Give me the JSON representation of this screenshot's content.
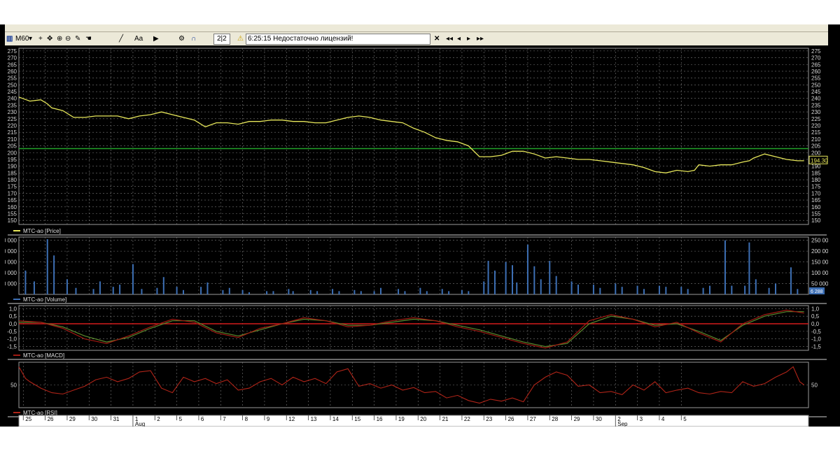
{
  "toolbar": {
    "timeframe": "M60",
    "font_button": "Aa",
    "counter": "2|2",
    "status": "6:25:15  Недостаточно лицензий!",
    "nav_buttons": [
      "◂◂",
      "◂",
      "▸",
      "▸▸"
    ]
  },
  "colors": {
    "price": "#e6e65a",
    "level": "#22a32a",
    "volume": "#3d6fb4",
    "macd": "#a01a12",
    "signal": "#5c8a2e",
    "rsi": "#b02418",
    "grid": "#7a7a7a"
  },
  "chart_data": [
    {
      "type": "line",
      "name": "MTC-ao [Price]",
      "legend": "MTC-ao [Price]",
      "ylim": [
        147,
        277
      ],
      "yticks": [
        275,
        270,
        265,
        260,
        255,
        250,
        245,
        240,
        235,
        230,
        225,
        220,
        215,
        210,
        205,
        200,
        195,
        190,
        185,
        180,
        175,
        170,
        165,
        160,
        155,
        150
      ],
      "hline": 203,
      "last_value": "194.30",
      "x": [
        0,
        0.5,
        1,
        1.3,
        1.5,
        2,
        2.5,
        3,
        3.5,
        4,
        4.5,
        5,
        5.5,
        6,
        6.5,
        7,
        7.5,
        8,
        8.5,
        9,
        9.5,
        10,
        10.5,
        11,
        11.5,
        12,
        12.5,
        13,
        13.5,
        14,
        14.5,
        15,
        15.5,
        16,
        16.5,
        17,
        17.5,
        18,
        18.5,
        19,
        19.5,
        20,
        20.5,
        21,
        21.5,
        22,
        22.5,
        23,
        23.5,
        24,
        24.5,
        25,
        25.5,
        26,
        26.5,
        27,
        27.5,
        28,
        28.5,
        29,
        29.5,
        30,
        30.5,
        30.8,
        31,
        31.5,
        32,
        32.5,
        33,
        33.3,
        33.5,
        34,
        34.5,
        35,
        35.5,
        35.8
      ],
      "values": [
        241,
        238,
        239,
        236,
        233,
        231,
        226,
        226,
        227,
        227,
        227,
        225,
        227,
        228,
        230,
        228,
        226,
        224,
        219,
        222,
        222,
        221,
        223,
        223,
        224,
        224,
        223,
        223,
        222,
        222,
        224,
        226,
        227,
        226,
        224,
        223,
        222,
        218,
        215,
        211,
        209,
        208,
        205,
        197,
        197,
        198,
        201,
        201,
        199,
        196,
        197,
        196,
        195,
        195,
        194,
        193,
        192,
        191,
        189,
        186,
        185,
        187,
        186,
        187,
        191,
        190,
        191,
        191,
        193,
        194,
        196,
        199,
        197,
        195,
        194,
        194
      ]
    },
    {
      "type": "bar",
      "name": "MTC-ao [Volume]",
      "legend": "MTC-ao [Volume]",
      "ylim": [
        0,
        265000
      ],
      "yticks": [
        {
          "v": 250000,
          "label": "250 000"
        },
        {
          "v": 200000,
          "label": "200 000"
        },
        {
          "v": 150000,
          "label": "150 000"
        },
        {
          "v": 100000,
          "label": "100 000"
        },
        {
          "v": 50000,
          "label": "50 000"
        }
      ],
      "last_value": "6 288",
      "x": [
        0.3,
        0.7,
        1.3,
        1.6,
        2.2,
        2.6,
        3.4,
        3.7,
        4.3,
        4.6,
        5.2,
        5.6,
        6.3,
        6.6,
        7.2,
        7.5,
        8.3,
        8.6,
        9.3,
        9.6,
        10.2,
        10.5,
        11.3,
        11.6,
        12.3,
        12.5,
        13.3,
        13.6,
        14.3,
        14.6,
        15.3,
        15.6,
        16.2,
        16.5,
        17.3,
        17.6,
        18.3,
        18.6,
        19.3,
        19.6,
        20.2,
        20.5,
        21.2,
        21.4,
        21.7,
        22.2,
        22.5,
        22.7,
        23.2,
        23.5,
        23.8,
        24.2,
        24.5,
        25.2,
        25.5,
        26.2,
        26.5,
        27.2,
        27.5,
        28.2,
        28.5,
        29.2,
        29.5,
        30.2,
        30.5,
        31.2,
        31.5,
        32.2,
        32.5,
        33.1,
        33.3,
        33.6,
        34.2,
        34.5,
        35.2,
        35.5
      ],
      "values": [
        110000,
        60000,
        255000,
        180000,
        70000,
        30000,
        25000,
        60000,
        35000,
        45000,
        140000,
        25000,
        30000,
        80000,
        35000,
        20000,
        35000,
        55000,
        20000,
        30000,
        20000,
        10000,
        15000,
        15000,
        25000,
        15000,
        20000,
        15000,
        25000,
        15000,
        20000,
        15000,
        15000,
        30000,
        25000,
        15000,
        30000,
        15000,
        25000,
        15000,
        20000,
        15000,
        60000,
        155000,
        110000,
        150000,
        135000,
        55000,
        230000,
        130000,
        70000,
        155000,
        85000,
        60000,
        45000,
        45000,
        30000,
        50000,
        35000,
        40000,
        25000,
        40000,
        35000,
        35000,
        25000,
        30000,
        40000,
        250000,
        40000,
        40000,
        240000,
        70000,
        30000,
        50000,
        125000,
        25000
      ]
    },
    {
      "type": "line",
      "name": "MTC-ao [MACD]",
      "legend": "MTC-ao [MACD]",
      "ylim": [
        -1.75,
        1.2
      ],
      "yticks": [
        {
          "v": 1.0,
          "label": "1,0"
        },
        {
          "v": 0.5,
          "label": "0,5"
        },
        {
          "v": 0.0,
          "label": "0,0"
        },
        {
          "v": -0.5,
          "label": "-0,5"
        },
        {
          "v": -1.0,
          "label": "-1,0"
        },
        {
          "v": -1.5,
          "label": "-1,5"
        }
      ],
      "hline": 0,
      "x": [
        0,
        1,
        2,
        3,
        4,
        5,
        6,
        7,
        8,
        9,
        10,
        11,
        12,
        13,
        14,
        15,
        16,
        17,
        18,
        19,
        20,
        21,
        22,
        23,
        24,
        25,
        26,
        27,
        28,
        29,
        30,
        31,
        32,
        33,
        34,
        35,
        35.8
      ],
      "series": [
        {
          "role": "macd",
          "values": [
            0.2,
            0.1,
            -0.3,
            -1.0,
            -1.3,
            -0.8,
            -0.2,
            0.3,
            0.1,
            -0.6,
            -0.9,
            -0.3,
            0.0,
            0.4,
            0.2,
            -0.2,
            -0.1,
            0.2,
            0.4,
            0.2,
            -0.2,
            -0.5,
            -0.9,
            -1.3,
            -1.6,
            -1.2,
            0.2,
            0.6,
            0.3,
            -0.2,
            0.1,
            -0.6,
            -1.2,
            0.0,
            0.6,
            0.9,
            0.7
          ]
        },
        {
          "role": "signal",
          "values": [
            0.1,
            0.1,
            -0.2,
            -0.8,
            -1.2,
            -0.9,
            -0.3,
            0.2,
            0.2,
            -0.5,
            -0.8,
            -0.4,
            0.0,
            0.3,
            0.2,
            -0.1,
            -0.1,
            0.1,
            0.3,
            0.2,
            -0.1,
            -0.4,
            -0.8,
            -1.2,
            -1.5,
            -1.3,
            0.0,
            0.5,
            0.3,
            -0.1,
            0.0,
            -0.5,
            -1.1,
            -0.1,
            0.5,
            0.8,
            0.8
          ]
        }
      ]
    },
    {
      "type": "line",
      "name": "MTC-ao [RSI]",
      "legend": "MTC-ao [RSI]",
      "ylim": [
        15,
        85
      ],
      "yticks": [
        {
          "v": 50,
          "label": "50"
        }
      ],
      "x": [
        0,
        0.3,
        0.5,
        1,
        1.5,
        2,
        2.5,
        3,
        3.5,
        4,
        4.5,
        5,
        5.5,
        6,
        6.5,
        7,
        7.5,
        8,
        8.5,
        9,
        9.5,
        10,
        10.5,
        11,
        11.5,
        12,
        12.5,
        13,
        13.5,
        14,
        14.5,
        15,
        15.5,
        16,
        16.5,
        17,
        17.5,
        18,
        18.5,
        19,
        19.5,
        20,
        20.5,
        21,
        21.5,
        22,
        22.5,
        23,
        23.5,
        24,
        24.5,
        25,
        25.5,
        26,
        26.5,
        27,
        27.5,
        28,
        28.5,
        29,
        29.5,
        30,
        30.5,
        31,
        31.5,
        32,
        32.5,
        33,
        33.5,
        34,
        34.5,
        35,
        35.3,
        35.6,
        35.8
      ],
      "values": [
        78,
        60,
        55,
        45,
        38,
        36,
        42,
        48,
        58,
        62,
        55,
        60,
        70,
        72,
        45,
        38,
        62,
        55,
        60,
        52,
        58,
        42,
        45,
        55,
        60,
        50,
        62,
        55,
        60,
        52,
        70,
        75,
        48,
        52,
        45,
        50,
        42,
        46,
        38,
        40,
        30,
        34,
        26,
        22,
        28,
        25,
        30,
        24,
        50,
        62,
        70,
        65,
        48,
        50,
        38,
        40,
        35,
        50,
        42,
        55,
        38,
        42,
        45,
        38,
        36,
        40,
        38,
        55,
        48,
        52,
        62,
        70,
        78,
        55,
        50
      ]
    }
  ],
  "xaxis": {
    "days": [
      {
        "x": 0.2,
        "label": "25"
      },
      {
        "x": 1.2,
        "label": "26"
      },
      {
        "x": 2.2,
        "label": "29"
      },
      {
        "x": 3.2,
        "label": "30"
      },
      {
        "x": 4.2,
        "label": "31"
      },
      {
        "x": 5.2,
        "label": "1"
      },
      {
        "x": 6.2,
        "label": "2"
      },
      {
        "x": 7.2,
        "label": "5"
      },
      {
        "x": 8.2,
        "label": "6"
      },
      {
        "x": 9.2,
        "label": "7"
      },
      {
        "x": 10.2,
        "label": "8"
      },
      {
        "x": 11.2,
        "label": "9"
      },
      {
        "x": 12.2,
        "label": "12"
      },
      {
        "x": 13.2,
        "label": "13"
      },
      {
        "x": 14.2,
        "label": "14"
      },
      {
        "x": 15.2,
        "label": "15"
      },
      {
        "x": 16.2,
        "label": "16"
      },
      {
        "x": 17.2,
        "label": "19"
      },
      {
        "x": 18.2,
        "label": "20"
      },
      {
        "x": 19.2,
        "label": "21"
      },
      {
        "x": 20.2,
        "label": "22"
      },
      {
        "x": 21.2,
        "label": "23"
      },
      {
        "x": 22.2,
        "label": "26"
      },
      {
        "x": 23.2,
        "label": "27"
      },
      {
        "x": 24.2,
        "label": "28"
      },
      {
        "x": 25.2,
        "label": "29"
      },
      {
        "x": 26.2,
        "label": "30"
      },
      {
        "x": 27.2,
        "label": "2"
      },
      {
        "x": 28.2,
        "label": "3"
      },
      {
        "x": 29.2,
        "label": "4"
      },
      {
        "x": 30.2,
        "label": "5"
      }
    ],
    "months": [
      {
        "x": 5.2,
        "label": "Aug"
      },
      {
        "x": 27.2,
        "label": "Sep"
      }
    ],
    "range": [
      0,
      36
    ]
  }
}
